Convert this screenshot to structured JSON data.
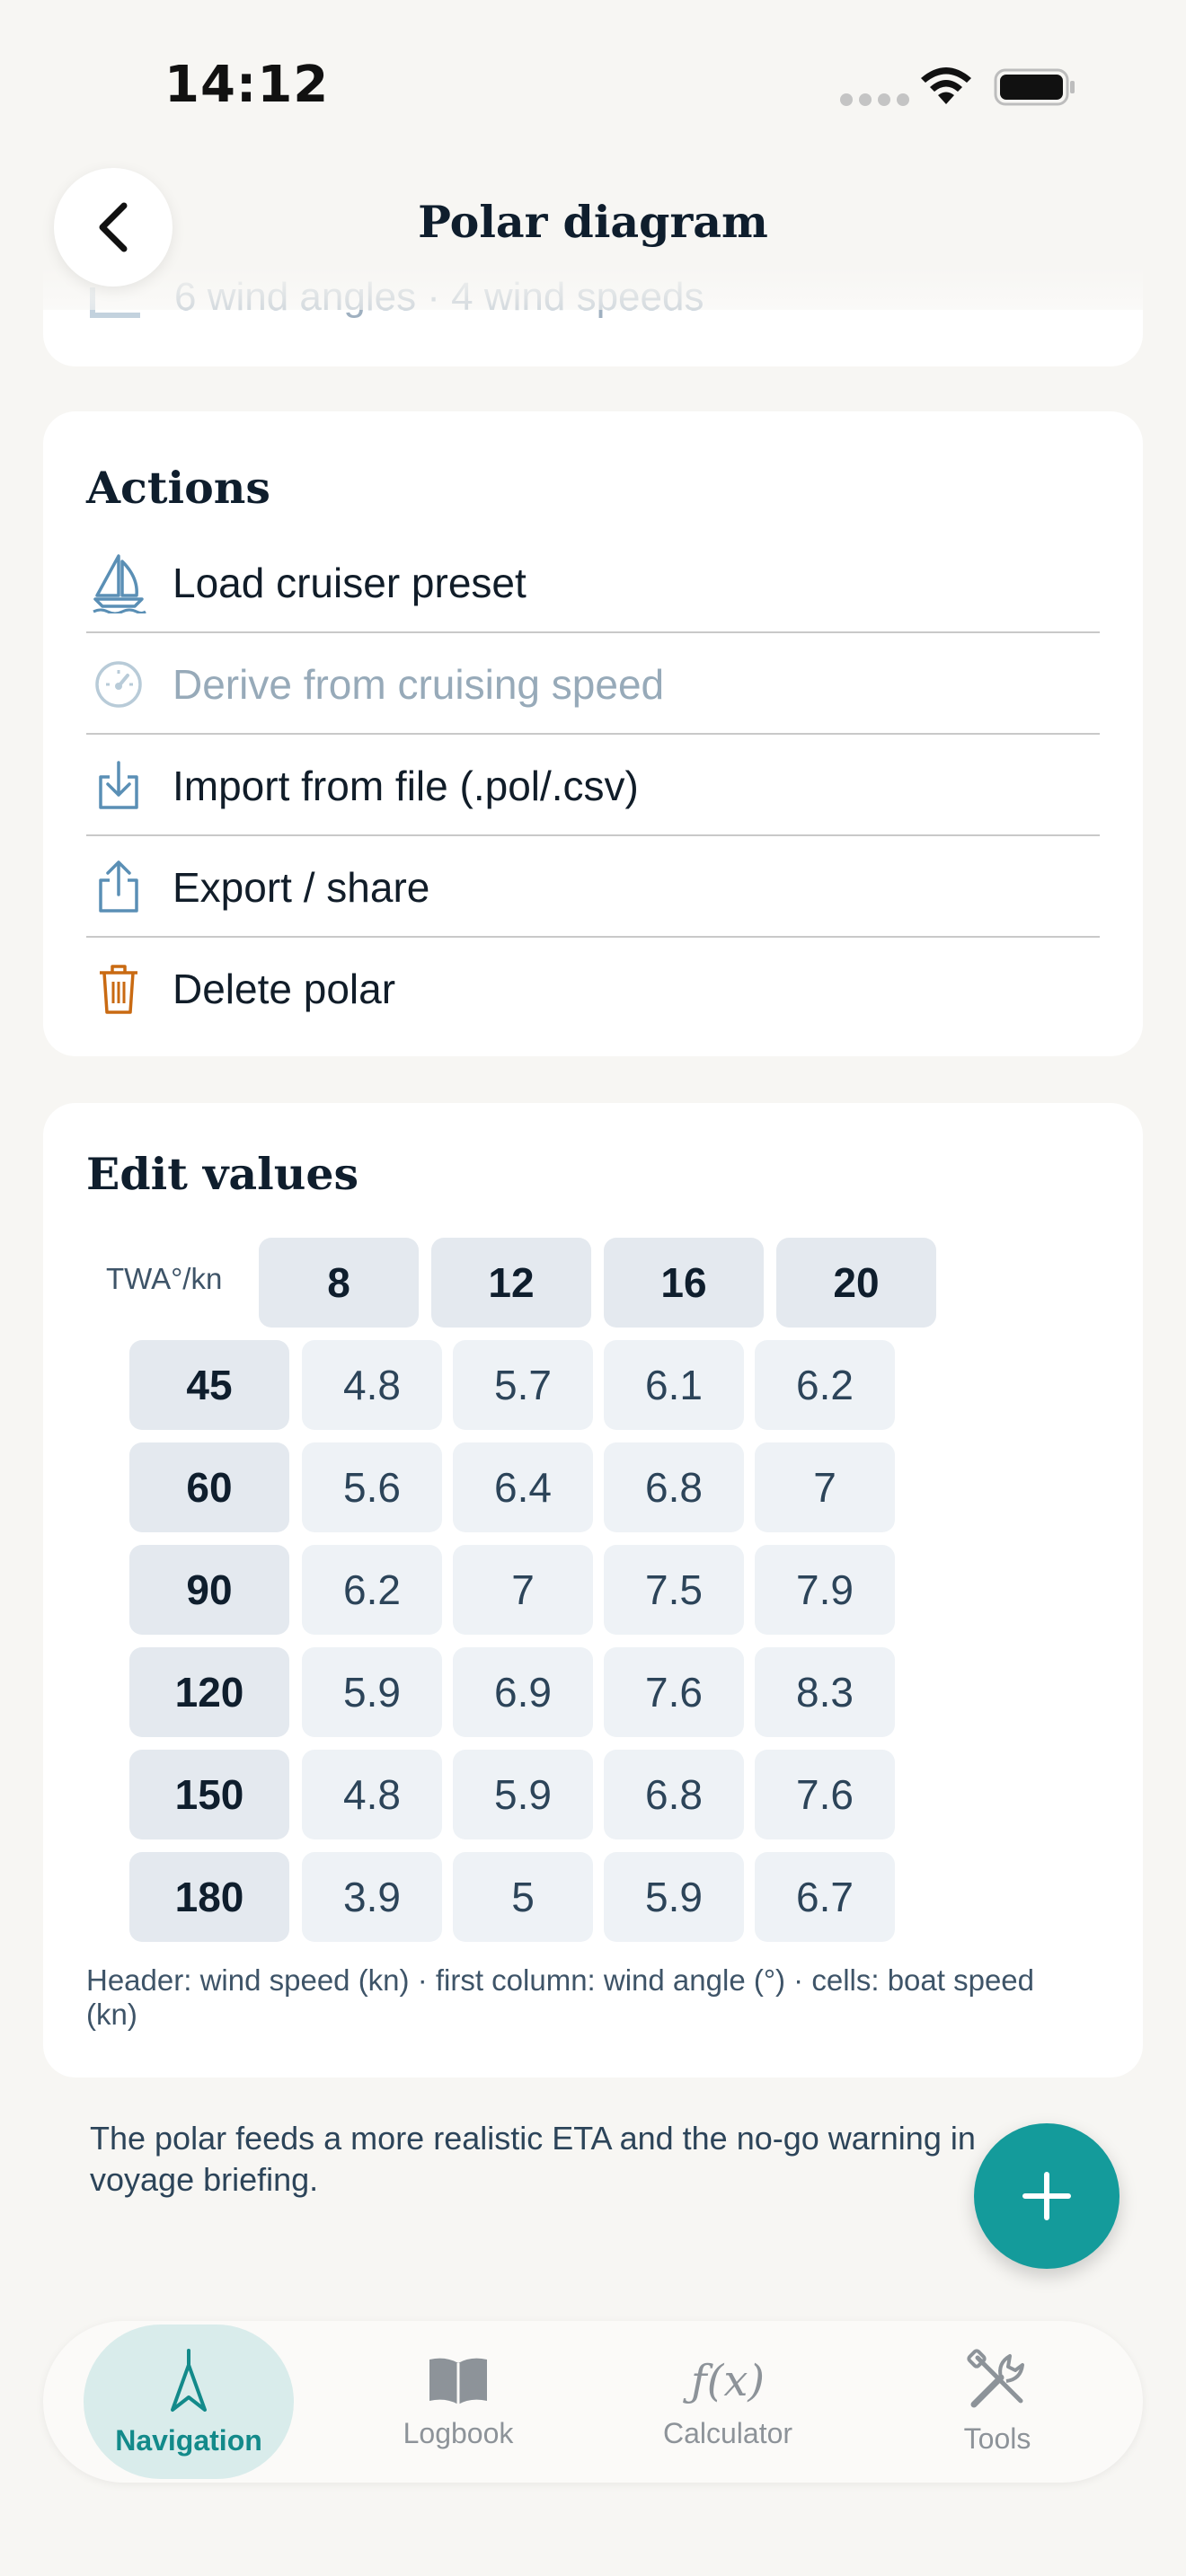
{
  "status": {
    "time": "14:12"
  },
  "header": {
    "title": "Polar diagram"
  },
  "previous_card": {
    "text": "6 wind angles · 4 wind speeds"
  },
  "actions": {
    "title": "Actions",
    "items": [
      {
        "label": "Load cruiser preset",
        "icon": "sailboat-icon",
        "enabled": true
      },
      {
        "label": "Derive from cruising speed",
        "icon": "speedometer-icon",
        "enabled": false
      },
      {
        "label": "Import from file (.pol/.csv)",
        "icon": "download-icon",
        "enabled": true
      },
      {
        "label": "Export / share",
        "icon": "share-icon",
        "enabled": true
      },
      {
        "label": "Delete polar",
        "icon": "trash-icon",
        "enabled": true
      }
    ]
  },
  "edit": {
    "title": "Edit values",
    "corner_label": "TWA°/kn",
    "wind_speeds": [
      "8",
      "12",
      "16",
      "20"
    ],
    "rows": [
      {
        "angle": "45",
        "values": [
          "4.8",
          "5.7",
          "6.1",
          "6.2"
        ]
      },
      {
        "angle": "60",
        "values": [
          "5.6",
          "6.4",
          "6.8",
          "7"
        ]
      },
      {
        "angle": "90",
        "values": [
          "6.2",
          "7",
          "7.5",
          "7.9"
        ]
      },
      {
        "angle": "120",
        "values": [
          "5.9",
          "6.9",
          "7.6",
          "8.3"
        ]
      },
      {
        "angle": "150",
        "values": [
          "4.8",
          "5.9",
          "6.8",
          "7.6"
        ]
      },
      {
        "angle": "180",
        "values": [
          "3.9",
          "5",
          "5.9",
          "6.7"
        ]
      }
    ],
    "caption": "Header: wind speed (kn) · first column: wind angle (°) · cells: boat speed (kn)"
  },
  "footer_note": "The polar feeds a more realistic ETA and the no-go warning in voyage briefing.",
  "tabs": [
    {
      "label": "Navigation",
      "icon": "navigation-arrow-icon",
      "active": true
    },
    {
      "label": "Logbook",
      "icon": "book-icon",
      "active": false
    },
    {
      "label": "Calculator",
      "icon": "function-icon",
      "active": false
    },
    {
      "label": "Tools",
      "icon": "tools-icon",
      "active": false
    }
  ],
  "colors": {
    "accent": "#149b9b",
    "danger": "#c96a12",
    "action_icon": "#5a8fb5"
  }
}
